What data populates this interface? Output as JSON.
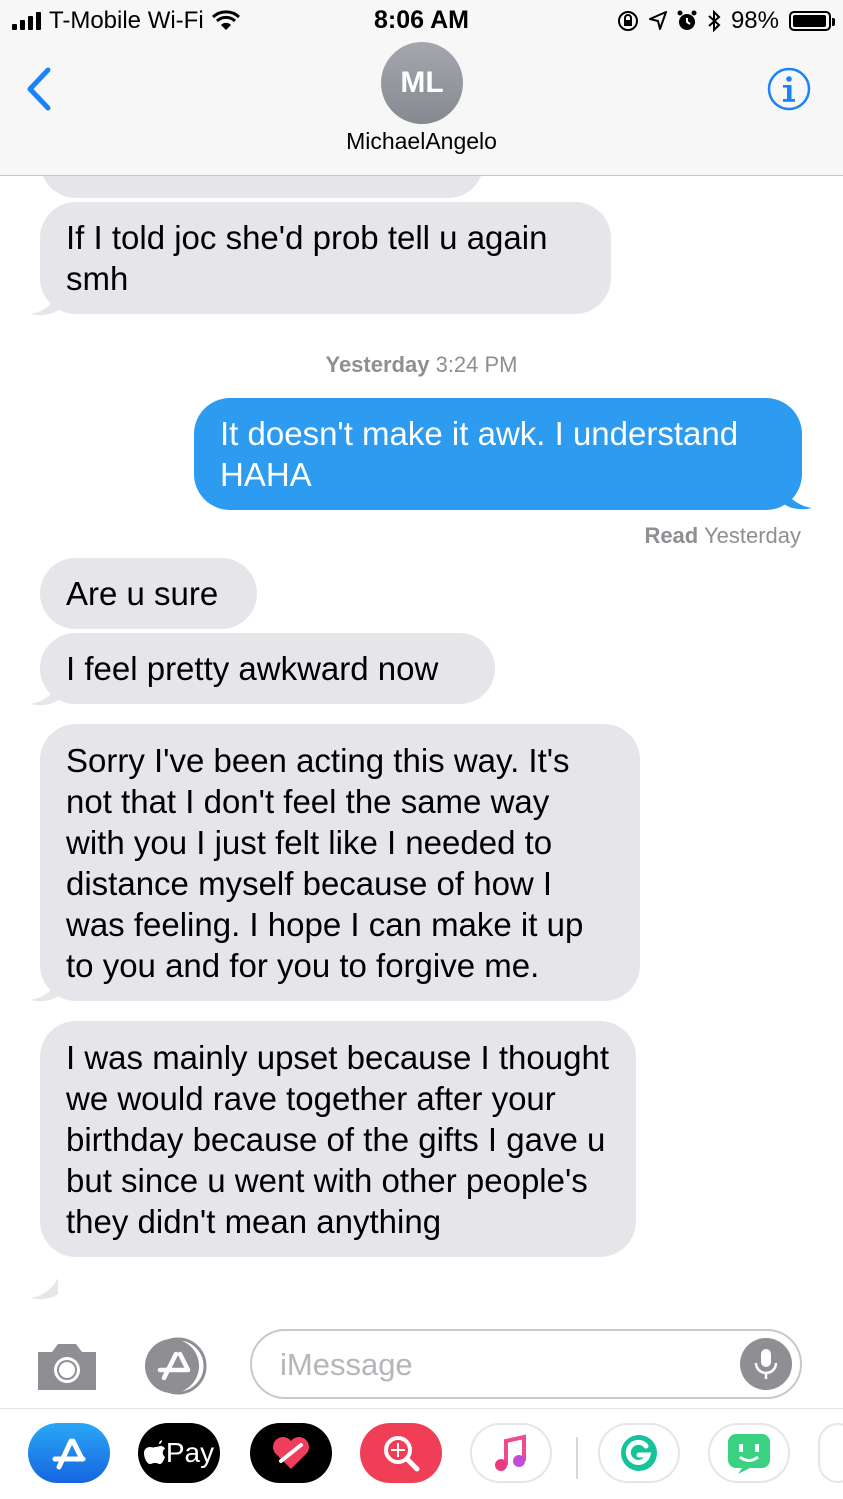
{
  "status_bar": {
    "carrier": "T-Mobile Wi-Fi",
    "time": "8:06 AM",
    "battery": "98%",
    "battery_level": 0.98
  },
  "header": {
    "avatar_initials": "ML",
    "contact_name": "MichaelAngelo"
  },
  "messages": [
    {
      "type": "incoming",
      "text": "If I told joc she'd prob tell u again smh"
    },
    {
      "type": "timestamp",
      "day": "Yesterday",
      "time": "3:24 PM"
    },
    {
      "type": "outgoing",
      "text": "It doesn't make it awk. I understand HAHA"
    },
    {
      "type": "receipt",
      "label": "Read",
      "when": "Yesterday"
    },
    {
      "type": "incoming",
      "text": "Are u sure"
    },
    {
      "type": "incoming",
      "text": "I feel pretty awkward now"
    },
    {
      "type": "incoming",
      "text": "Sorry I've been acting this way. It's not that I don't feel the same way with you I just felt like I needed to distance myself because of how I was feeling. I hope I can make it up to you and for you to forgive me."
    },
    {
      "type": "incoming",
      "text": "I was mainly upset because I thought we would rave together after your birthday because of the gifts I gave u but since u went with other people's they didn't mean anything"
    }
  ],
  "input": {
    "placeholder": "iMessage",
    "value": ""
  },
  "app_drawer": {
    "apple_pay_label": "Pay",
    "icons": [
      "app-store-icon",
      "apple-pay-icon",
      "digital-touch-icon",
      "web-images-icon",
      "music-icon",
      "grammarly-icon",
      "bitmoji-icon"
    ]
  },
  "colors": {
    "accent": "#1a82fb",
    "outgoing_bubble": "#2d9bf0",
    "incoming_bubble": "#e5e5ea"
  }
}
